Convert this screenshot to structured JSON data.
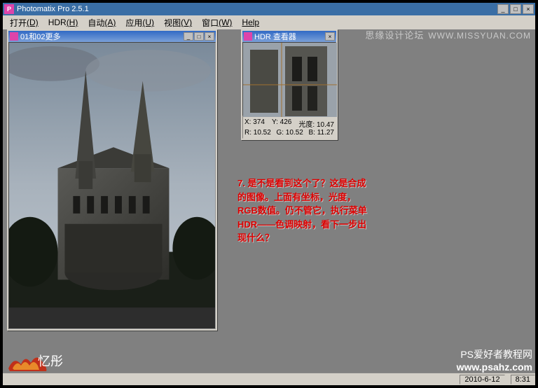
{
  "title": "Photomatix Pro 2.5.1",
  "menu": {
    "open": "打开",
    "open_k": "(D)",
    "hdr": "HDR",
    "hdr_k": "(H)",
    "auto": "自动",
    "auto_k": "(A)",
    "app": "应用",
    "app_k": "(U)",
    "view": "视图",
    "view_k": "(V)",
    "window": "窗口",
    "window_k": "(W)",
    "help": "Help"
  },
  "docwin": {
    "title": "01和02更多"
  },
  "hdrviewer": {
    "title": "HDR 查看器",
    "x_label": "X:",
    "x": "374",
    "y_label": "Y:",
    "y": "426",
    "lum_label": "光度:",
    "lum": "10.47",
    "r_label": "R:",
    "r": "10.52",
    "g_label": "G:",
    "g": "10.52",
    "b_label": "B:",
    "b": "11.27"
  },
  "annotation": "7. 是不是看到这个了？这是合成的图像。上面有坐标，光度，RGB数值。仍不管它，执行菜单HDR——色调映射，看下一步出现什么？",
  "status": {
    "date": "2010-6-12",
    "time": "8:31"
  },
  "watermarks": {
    "top_cn": "思缘设计论坛",
    "top_url": "WWW.MISSYUAN.COM",
    "bl_txt": "忆彤",
    "br_cn": "PS爱好者教程网",
    "br_url": "www.psahz.com"
  },
  "icons": {
    "minimize": "_",
    "maximize": "□",
    "close": "×"
  }
}
